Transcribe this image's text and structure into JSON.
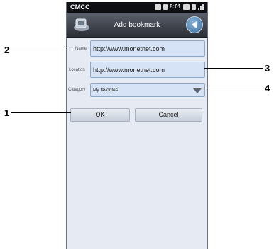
{
  "status_bar": {
    "carrier": "CMCC",
    "time": "8:01"
  },
  "titlebar": {
    "title": "Add bookmark"
  },
  "form": {
    "name_label": "Name",
    "name_value": "http://www.monetnet.com",
    "location_label": "Location",
    "location_value": "http://www.monetnet.com",
    "category_label": "Category",
    "category_value": "My favorites"
  },
  "buttons": {
    "ok": "OK",
    "cancel": "Cancel"
  },
  "callouts": [
    "1",
    "2",
    "3",
    "4"
  ]
}
